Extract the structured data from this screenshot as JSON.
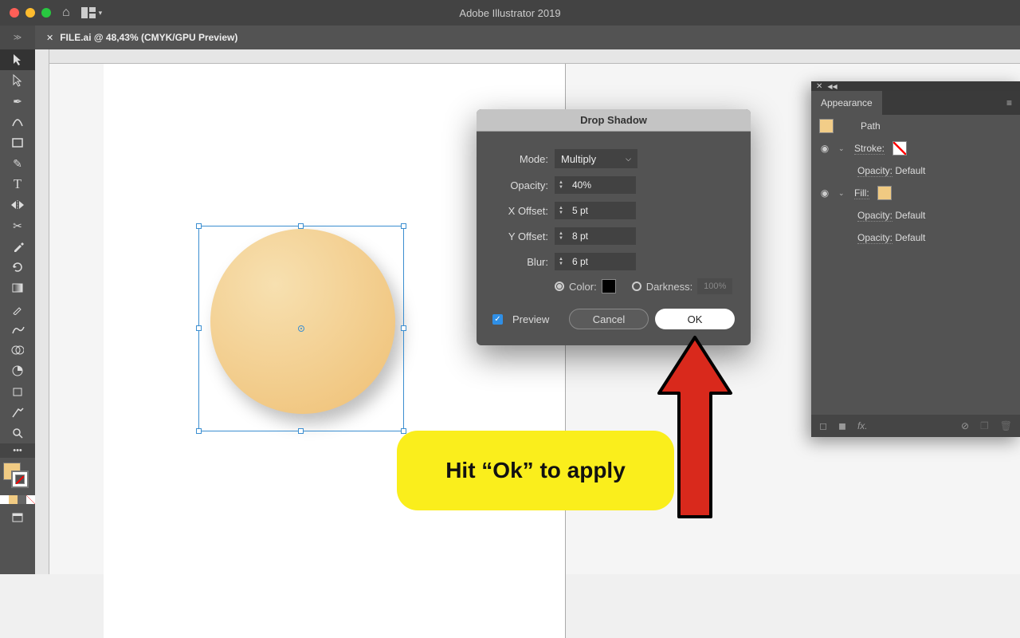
{
  "app": {
    "title": "Adobe Illustrator 2019"
  },
  "document": {
    "tab_label": "FILE.ai @ 48,43% (CMYK/GPU Preview)"
  },
  "dialog": {
    "title": "Drop Shadow",
    "mode_label": "Mode:",
    "mode_value": "Multiply",
    "opacity_label": "Opacity:",
    "opacity_value": "40%",
    "xoffset_label": "X Offset:",
    "xoffset_value": "5 pt",
    "yoffset_label": "Y Offset:",
    "yoffset_value": "8 pt",
    "blur_label": "Blur:",
    "blur_value": "6 pt",
    "color_label": "Color:",
    "darkness_label": "Darkness:",
    "darkness_value": "100%",
    "preview_label": "Preview",
    "cancel_label": "Cancel",
    "ok_label": "OK"
  },
  "appearance": {
    "panel_title": "Appearance",
    "object_type": "Path",
    "stroke_label": "Stroke:",
    "fill_label": "Fill:",
    "opacity_label": "Opacity:",
    "opacity_value": "Default",
    "fx_label": "fx."
  },
  "annotation": {
    "text": "Hit “Ok” to apply"
  }
}
